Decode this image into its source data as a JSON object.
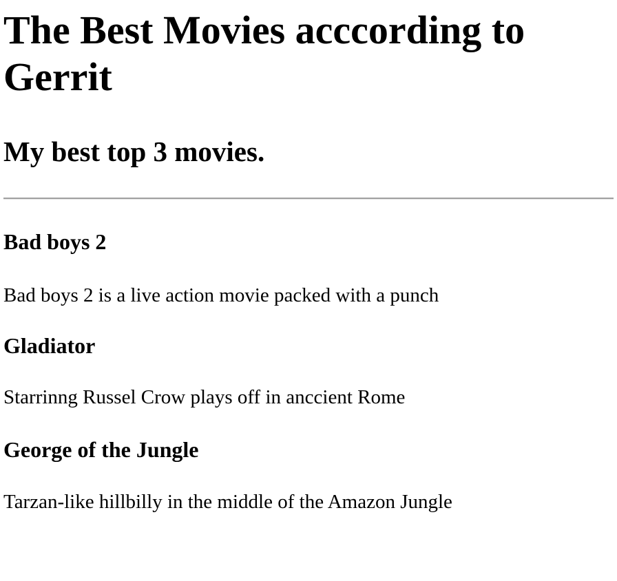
{
  "page": {
    "title": "The Best Movies acccording to Gerrit",
    "subtitle": "My best top 3 movies."
  },
  "movies": [
    {
      "title": "Bad boys 2",
      "description": "Bad boys 2 is a live action movie packed with a punch"
    },
    {
      "title": "Gladiator",
      "description": "Starrinng Russel Crow plays off in anccient Rome"
    },
    {
      "title": "George of the Jungle",
      "description": "Tarzan-like hillbilly in the middle of the Amazon Jungle"
    }
  ]
}
